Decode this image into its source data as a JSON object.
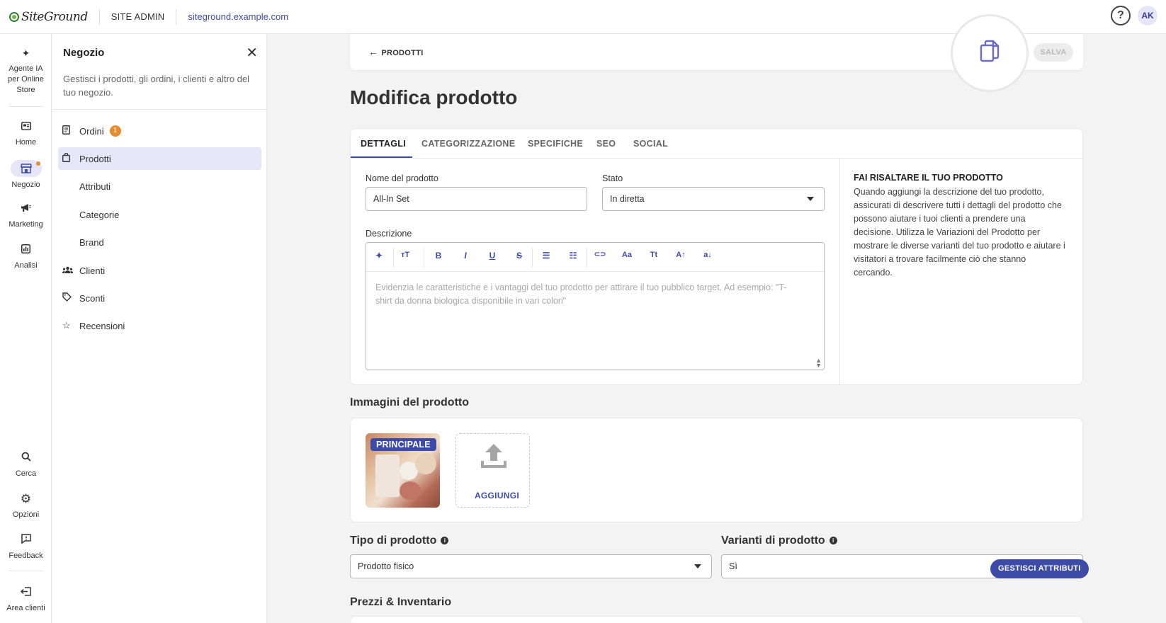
{
  "topbar": {
    "brand": "SiteGround",
    "site_admin": "SITE ADMIN",
    "site_url": "siteground.example.com",
    "help": "?",
    "avatar": "AK"
  },
  "rail": {
    "items": [
      {
        "label": "Agente IA per Online Store",
        "icon": "sparkle-icon"
      },
      {
        "label": "Home",
        "icon": "dashboard-icon"
      },
      {
        "label": "Negozio",
        "icon": "store-icon"
      },
      {
        "label": "Marketing",
        "icon": "megaphone-icon"
      },
      {
        "label": "Analisi",
        "icon": "chart-icon"
      },
      {
        "label": "Cerca",
        "icon": "search-icon"
      },
      {
        "label": "Opzioni",
        "icon": "gear-icon"
      },
      {
        "label": "Feedback",
        "icon": "feedback-icon"
      },
      {
        "label": "Area clienti",
        "icon": "exit-icon"
      }
    ]
  },
  "panel": {
    "title": "Negozio",
    "description": "Gestisci i prodotti, gli ordini, i clienti e altro del tuo negozio.",
    "menu": [
      {
        "label": "Ordini",
        "icon": "receipt-icon",
        "badge": "1"
      },
      {
        "label": "Prodotti",
        "icon": "bag-icon"
      },
      {
        "label": "Attributi"
      },
      {
        "label": "Categorie"
      },
      {
        "label": "Brand"
      },
      {
        "label": "Clienti",
        "icon": "people-icon"
      },
      {
        "label": "Sconti",
        "icon": "tag-icon"
      },
      {
        "label": "Recensioni",
        "icon": "star-icon"
      }
    ]
  },
  "header": {
    "back_label": "PRODOTTI",
    "save_label": "SALVA",
    "copy_icon": "copy-icon"
  },
  "page": {
    "title": "Modifica prodotto"
  },
  "tabs": [
    "DETTAGLI",
    "CATEGORIZZAZIONE",
    "SPECIFICHE",
    "SEO",
    "SOCIAL"
  ],
  "form": {
    "name_label": "Nome del prodotto",
    "name_value": "All-In Set",
    "status_label": "Stato",
    "status_value": "In diretta",
    "description_label": "Descrizione",
    "description_placeholder": "Evidenzia le caratteristiche e i vantaggi del tuo prodotto per attirare il tuo pubblico target. Ad esempio: \"T-shirt da donna biologica disponibile in vari colori\""
  },
  "toolbar": {
    "buttons": [
      {
        "name": "ai-sparkle-icon",
        "glyph": "✦"
      },
      {
        "name": "text-size-icon",
        "glyph": "ᴛT"
      },
      {
        "name": "bold-icon",
        "glyph": "B"
      },
      {
        "name": "italic-icon",
        "glyph": "I"
      },
      {
        "name": "underline-icon",
        "glyph": "U"
      },
      {
        "name": "strikethrough-icon",
        "glyph": "S"
      },
      {
        "name": "bullet-list-icon",
        "glyph": "☰"
      },
      {
        "name": "numbered-list-icon",
        "glyph": "☷"
      },
      {
        "name": "link-icon",
        "glyph": "⊂⊃"
      },
      {
        "name": "font-case-icon",
        "glyph": "Aa"
      },
      {
        "name": "title-case-icon",
        "glyph": "Tt"
      },
      {
        "name": "uppercase-icon",
        "glyph": "A↑"
      },
      {
        "name": "lowercase-icon",
        "glyph": "a↓"
      }
    ]
  },
  "tip": {
    "title": "FAI RISALTARE IL TUO PRODOTTO",
    "body": "Quando aggiungi la descrizione del tuo prodotto, assicurati di descrivere tutti i dettagli del prodotto che possono aiutare i tuoi clienti a prendere una decisione. Utilizza le Variazioni del Prodotto per mostrare le diverse varianti del tuo prodotto e aiutare i visitatori a trovare facilmente ciò che stanno cercando."
  },
  "images": {
    "title": "Immagini del prodotto",
    "main_badge": "PRINCIPALE",
    "add_label": "AGGIUNGI"
  },
  "product_type": {
    "title": "Tipo di prodotto",
    "value": "Prodotto fisico"
  },
  "variants": {
    "title": "Varianti di prodotto",
    "value": "Sì"
  },
  "pricing": {
    "title": "Prezzi & Inventario",
    "manage_label": "GESTISCI ATTRIBUTI"
  },
  "colors": {
    "accent": "#3d4ba8",
    "badge": "#e88a2d",
    "active_bg": "#e7e6f8"
  }
}
